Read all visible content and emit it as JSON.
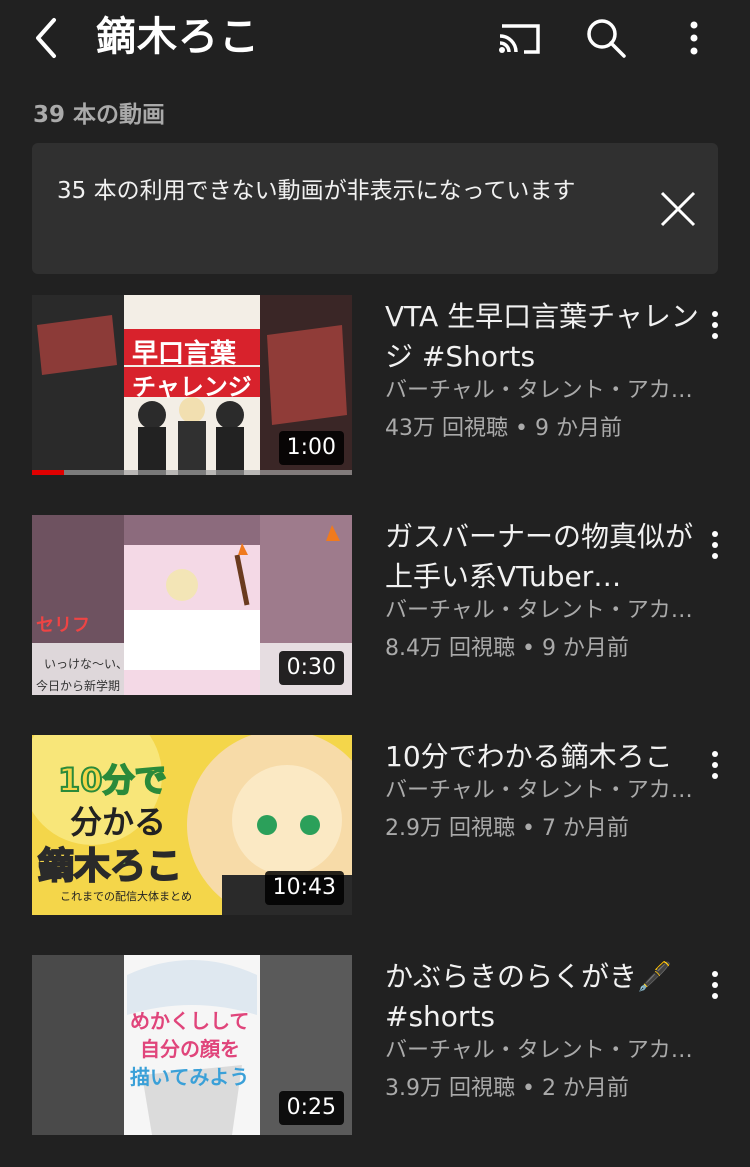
{
  "header": {
    "title": "鏑木ろこ",
    "icons": [
      "back-arrow-icon",
      "cast-icon",
      "search-icon",
      "more-vertical-icon"
    ]
  },
  "video_count": "39 本の動画",
  "notice": {
    "text": "35 本の利用できない動画が非表示になっています",
    "close_icon": "close-icon"
  },
  "videos": [
    {
      "title": "VTA 生早口言葉チャレンジ #Shorts",
      "channel": "バーチャル・タレント・アカデミー",
      "stats": "43万 回視聴 • 9 か月前",
      "duration": "1:00",
      "thumb_text": [
        "早口言葉",
        "チャレンジ"
      ],
      "watched_fraction": 0.1
    },
    {
      "title": "ガスバーナーの物真似が上手い系VTuber…",
      "channel": "バーチャル・タレント・アカデミー",
      "stats": "8.4万 回視聴 • 9 か月前",
      "duration": "0:30",
      "thumb_text": [
        "セリフ",
        "いっけな～い、",
        "今日から新学期"
      ]
    },
    {
      "title": "10分でわかる鏑木ろこ",
      "channel": "バーチャル・タレント・アカデミー",
      "stats": "2.9万 回視聴 • 7 か月前",
      "duration": "10:43",
      "thumb_text": [
        "10分で",
        "分かる",
        "鏑木ろこ",
        "これまでの配信大体まとめ"
      ]
    },
    {
      "title": "かぶらきのらくがき🖋️ #shorts",
      "channel": "バーチャル・タレント・アカデミー",
      "stats": "3.9万 回視聴 • 2 か月前",
      "duration": "0:25",
      "thumb_text": [
        "めかくしして",
        "自分の顔を",
        "描いてみよう"
      ]
    }
  ],
  "colors": {
    "background": "#212121",
    "notice_bg": "#303030",
    "secondary_text": "#aaaaaa",
    "progress_red": "#e00000"
  }
}
